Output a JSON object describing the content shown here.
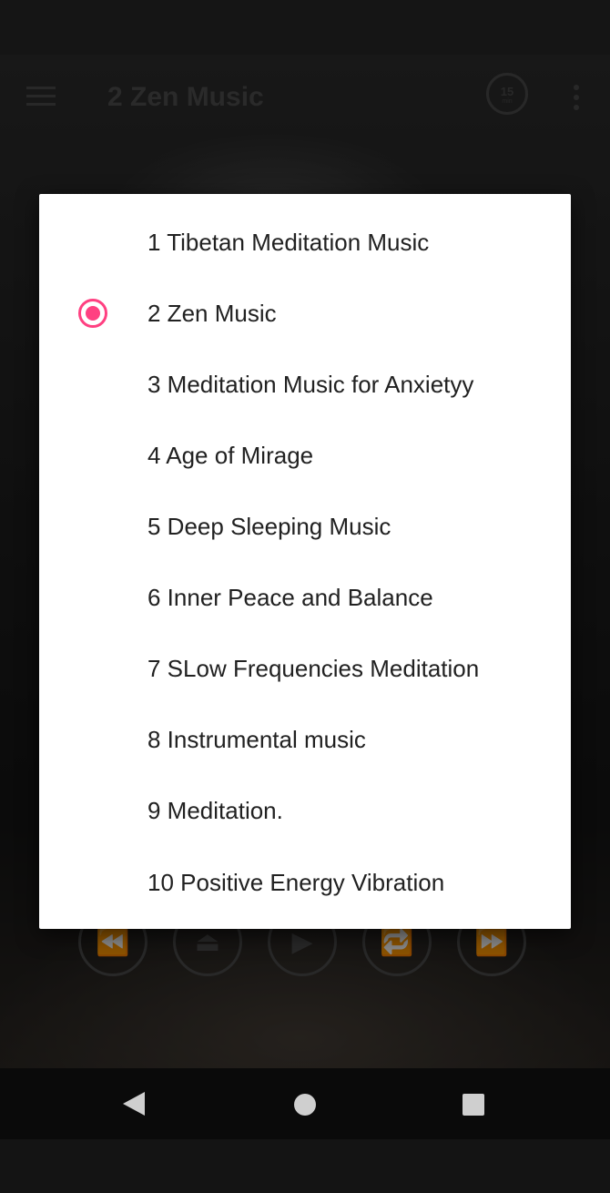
{
  "app": {
    "title": "2 Zen Music",
    "timer_minutes": "15",
    "timer_unit": "min"
  },
  "toolbar_icons": {
    "menu": "hamburger-menu-icon",
    "timer": "sleep-timer-icon",
    "overflow": "more-vert-icon"
  },
  "player_controls": [
    {
      "name": "rewind",
      "icon": "rewind-icon",
      "glyph": "⏪"
    },
    {
      "name": "eject",
      "icon": "eject-icon",
      "glyph": "⏏"
    },
    {
      "name": "play",
      "icon": "play-icon",
      "glyph": "▶"
    },
    {
      "name": "repeat",
      "icon": "repeat-icon",
      "glyph": "🔁"
    },
    {
      "name": "fast-forward",
      "icon": "fast-forward-icon",
      "glyph": "⏩"
    }
  ],
  "dialog": {
    "selected_index": 1,
    "options": [
      "1 Tibetan Meditation Music",
      "2 Zen Music",
      "3 Meditation Music for Anxietyy",
      "4 Age of Mirage",
      "5 Deep Sleeping Music",
      "6 Inner Peace and Balance",
      "7 SLow Frequencies Meditation",
      "8 Instrumental music",
      "9 Meditation.",
      "10 Positive Energy Vibration"
    ]
  },
  "colors": {
    "accent": "#ff4081",
    "dialog_bg": "#ffffff",
    "text": "#212121"
  }
}
